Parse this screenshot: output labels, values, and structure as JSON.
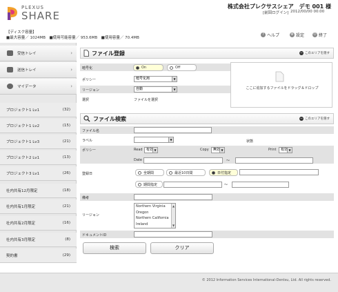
{
  "header": {
    "logo_small": "PLEXUS",
    "logo_big": "SHARE",
    "company": "株式会社プレクサスシェア　デモ 001 様",
    "login_status": "[前回ログイン]",
    "login_time": "2012/00/00 00:00"
  },
  "disk": {
    "title": "【ディスク容量】",
    "line": "■最大容量／ 1024MB　■使用可能容量／ 953.6MB　■使用容量／ 70.4MB"
  },
  "toplinks": {
    "help": "ヘルプ",
    "settings": "設定",
    "logout": "終了"
  },
  "sidebar": {
    "nav": [
      {
        "label": "受信トレイ"
      },
      {
        "label": "送信トレイ"
      },
      {
        "label": "マイデータ"
      }
    ],
    "projects": [
      {
        "label": "プロジェクト1 Lv1",
        "count": "(32)"
      },
      {
        "label": "プロジェクト1 Lv2",
        "count": "(15)"
      },
      {
        "label": "プロジェクト1 Lv3",
        "count": "(21)"
      },
      {
        "label": "プロジェクト2 Lv1",
        "count": "(13)"
      },
      {
        "label": "プロジェクト3 Lv1",
        "count": "(26)"
      },
      {
        "label": "社内共有12月限定",
        "count": "(18)"
      },
      {
        "label": "社内共有1月限定",
        "count": "(21)"
      },
      {
        "label": "社内共有2月限定",
        "count": "(16)"
      },
      {
        "label": "社内共有3月限定",
        "count": "(8)"
      },
      {
        "label": "契約書",
        "count": "(29)"
      }
    ]
  },
  "register": {
    "title": "ファイル登録",
    "hide": "このエリアを隠す",
    "encrypt_label": "暗号化",
    "on": "On",
    "off": "Off",
    "policy_label": "ポリシー",
    "policy_value": "暗号化用",
    "region_label": "リージョン",
    "region_value": "自動",
    "select_label": "選択",
    "select_value": "ファイルを選択",
    "drop_text": "ここに追加するファイルをドラッグ＆ドロップ"
  },
  "search": {
    "title": "ファイル検索",
    "hide": "このエリアを隠す",
    "filename_label": "ファイル名",
    "label_label": "ラベル",
    "state_label": "状態",
    "policy_label": "ポリシー",
    "read_label": "Read",
    "read_value": "有効",
    "copy_label": "Copy",
    "copy_value": "無効",
    "print_label": "Print",
    "print_value": "有効",
    "date_label": "Date",
    "tilde": "～",
    "regdate_label": "登録日",
    "opt_all": "全期間",
    "opt_recent": "最近10日間",
    "opt_date": "日付指定",
    "opt_range": "期間指定",
    "remarks_label": "備考",
    "region_label": "リージョン",
    "regions": [
      "Northern Virginia",
      "Oregon",
      "Northern California",
      "Ireland"
    ],
    "docid_label": "ドキュメントID",
    "search_button": "検索",
    "clear_button": "クリア"
  },
  "footer": {
    "copyright": "© 2012 Information Services International-Dentsu, Ltd. All rights reserved."
  }
}
